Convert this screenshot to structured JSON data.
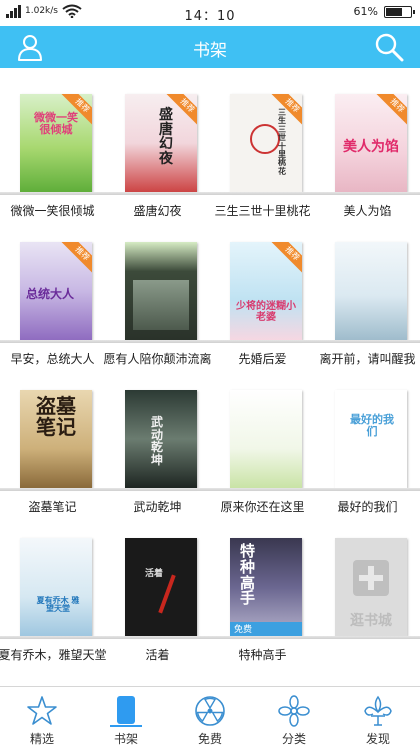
{
  "status": {
    "net_speed": "1.02k/s",
    "time": "14：10",
    "battery": "61%",
    "battery_level": 0.61
  },
  "header": {
    "title": "书架",
    "left_icon": "user-icon",
    "right_icon": "search-icon",
    "accent": "#3fc0f3"
  },
  "books": [
    {
      "label": "微微一笑很倾城",
      "cover_title": "微微一笑很倾城",
      "badge": "推荐"
    },
    {
      "label": "盛唐幻夜",
      "cover_title": "盛唐幻夜",
      "badge": "推荐"
    },
    {
      "label": "三生三世十里桃花",
      "cover_title": "三生三世十里桃花",
      "badge": "推荐"
    },
    {
      "label": "美人为馅",
      "cover_title": "美人为馅",
      "badge": "推荐"
    },
    {
      "label": "早安，总统大人",
      "cover_title": "总统大人",
      "badge": "推荐"
    },
    {
      "label": "愿有人陪你颠沛流离",
      "cover_title": "",
      "badge": ""
    },
    {
      "label": "先婚后爱",
      "cover_title": "少将的迷糊小老婆",
      "badge": "推荐"
    },
    {
      "label": "离开前，请叫醒我",
      "cover_title": "",
      "badge": ""
    },
    {
      "label": "盗墓笔记",
      "cover_title": "盗墓笔记",
      "badge": ""
    },
    {
      "label": "武动乾坤",
      "cover_title": "武动乾坤",
      "badge": ""
    },
    {
      "label": "原来你还在这里",
      "cover_title": "",
      "badge": ""
    },
    {
      "label": "最好的我们",
      "cover_title": "最好的我们",
      "badge": ""
    },
    {
      "label": "夏有乔木，雅望天堂",
      "cover_title": "夏有乔木 雅望天堂",
      "badge": ""
    },
    {
      "label": "活着",
      "cover_title": "活着",
      "badge": ""
    },
    {
      "label": "特种高手",
      "cover_title": "特种高手",
      "badge": "免费"
    }
  ],
  "add_book": {
    "label": "逛书城"
  },
  "bottom_nav": [
    {
      "label": "精选",
      "icon": "star-icon",
      "active": false
    },
    {
      "label": "书架",
      "icon": "bookshelf-icon",
      "active": true
    },
    {
      "label": "免费",
      "icon": "radiation-icon",
      "active": false
    },
    {
      "label": "分类",
      "icon": "flower-icon",
      "active": false
    },
    {
      "label": "发现",
      "icon": "fleur-icon",
      "active": false
    }
  ]
}
